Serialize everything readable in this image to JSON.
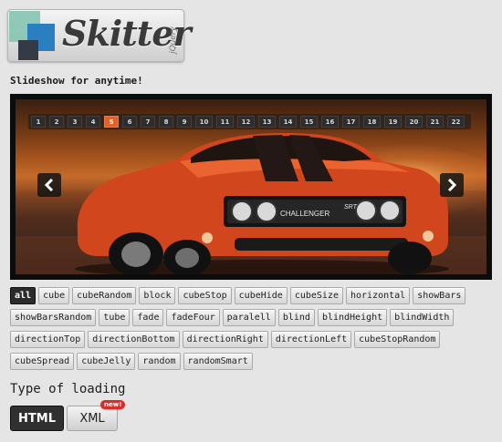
{
  "logo": {
    "name": "Skitter",
    "sub": "jQuery"
  },
  "tagline": "Slideshow for anytime!",
  "slider": {
    "pages": [
      "1",
      "2",
      "3",
      "4",
      "5",
      "6",
      "7",
      "8",
      "9",
      "10",
      "11",
      "12",
      "13",
      "14",
      "15",
      "16",
      "17",
      "18",
      "19",
      "20",
      "21",
      "22"
    ],
    "active_page": "5",
    "prev_icon": "chevron-left-icon",
    "next_icon": "chevron-right-icon",
    "image_badge": "CHALLENGER",
    "image_badge2": "SRT",
    "accent": "#e0632b"
  },
  "effects": [
    "all",
    "cube",
    "cubeRandom",
    "block",
    "cubeStop",
    "cubeHide",
    "cubeSize",
    "horizontal",
    "showBars",
    "showBarsRandom",
    "tube",
    "fade",
    "fadeFour",
    "paralell",
    "blind",
    "blindHeight",
    "blindWidth",
    "directionTop",
    "directionBottom",
    "directionRight",
    "directionLeft",
    "cubeStopRandom",
    "cubeSpread",
    "cubeJelly",
    "random",
    "randomSmart"
  ],
  "active_effect": "all",
  "loading": {
    "title": "Type of loading",
    "html_label": "HTML",
    "xml_label": "XML",
    "new_badge": "new!"
  }
}
